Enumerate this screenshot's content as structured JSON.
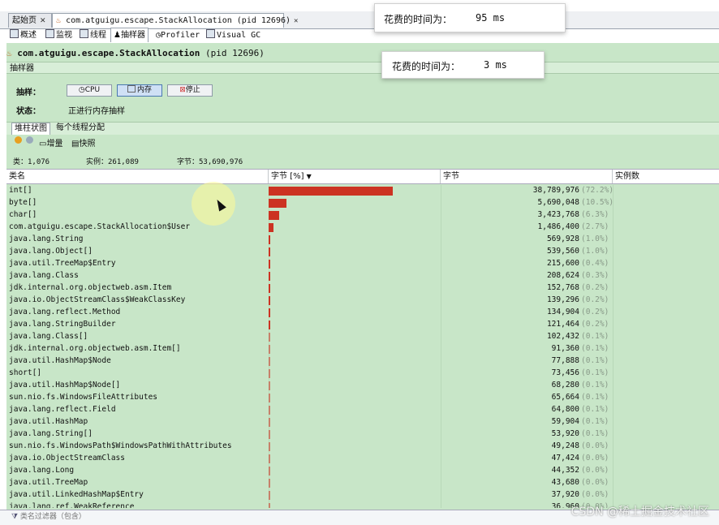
{
  "doc_tabs": [
    {
      "label": "起始页",
      "close": "✕"
    },
    {
      "label": "com.atguigu.escape.StackAllocation (pid 12696)",
      "close": "✕"
    }
  ],
  "sub_tabs": [
    "概述",
    "监视",
    "线程",
    "抽样器",
    "Profiler",
    "Visual GC"
  ],
  "title": {
    "name": "com.atguigu.escape.StackAllocation",
    "pid": "(pid 12696)"
  },
  "sampler_label": "抽样器",
  "sample_label": "抽样：",
  "buttons": {
    "cpu": "CPU",
    "memory": "内存",
    "stop": "停止"
  },
  "status_label": "状态：",
  "status_value": "正进行内存抽样",
  "view_tabs": [
    "堆柱状图",
    "每个线程分配"
  ],
  "toolbar": {
    "delta": "增量",
    "snapshot": "快照"
  },
  "summary": {
    "classes": "类：1,076",
    "instances": "实例：261,089",
    "bytes": "字节：53,690,976"
  },
  "columns": {
    "name": "类名",
    "bytes_pct": "字节 [%]",
    "bytes": "字节",
    "instances": "实例数"
  },
  "rows": [
    {
      "name": "int[]",
      "bytes": "38,789,976",
      "pct": "(72.2%)",
      "frac": 0.722
    },
    {
      "name": "byte[]",
      "bytes": "5,690,048",
      "pct": "(10.5%)",
      "frac": 0.105
    },
    {
      "name": "char[]",
      "bytes": "3,423,768",
      "pct": "(6.3%)",
      "frac": 0.063
    },
    {
      "name": "com.atguigu.escape.StackAllocation$User",
      "bytes": "1,486,400",
      "pct": "(2.7%)",
      "frac": 0.027
    },
    {
      "name": "java.lang.String",
      "bytes": "569,928",
      "pct": "(1.0%)",
      "frac": 0.01
    },
    {
      "name": "java.lang.Object[]",
      "bytes": "539,560",
      "pct": "(1.0%)",
      "frac": 0.01
    },
    {
      "name": "java.util.TreeMap$Entry",
      "bytes": "215,600",
      "pct": "(0.4%)",
      "frac": 0.004
    },
    {
      "name": "java.lang.Class",
      "bytes": "208,624",
      "pct": "(0.3%)",
      "frac": 0.003
    },
    {
      "name": "jdk.internal.org.objectweb.asm.Item",
      "bytes": "152,768",
      "pct": "(0.2%)",
      "frac": 0.002
    },
    {
      "name": "java.io.ObjectStreamClass$WeakClassKey",
      "bytes": "139,296",
      "pct": "(0.2%)",
      "frac": 0.002
    },
    {
      "name": "java.lang.reflect.Method",
      "bytes": "134,904",
      "pct": "(0.2%)",
      "frac": 0.002
    },
    {
      "name": "java.lang.StringBuilder",
      "bytes": "121,464",
      "pct": "(0.2%)",
      "frac": 0.002
    },
    {
      "name": "java.lang.Class[]",
      "bytes": "102,432",
      "pct": "(0.1%)",
      "frac": 0.001
    },
    {
      "name": "jdk.internal.org.objectweb.asm.Item[]",
      "bytes": "91,360",
      "pct": "(0.1%)",
      "frac": 0.001
    },
    {
      "name": "java.util.HashMap$Node",
      "bytes": "77,888",
      "pct": "(0.1%)",
      "frac": 0.001
    },
    {
      "name": "short[]",
      "bytes": "73,456",
      "pct": "(0.1%)",
      "frac": 0.001
    },
    {
      "name": "java.util.HashMap$Node[]",
      "bytes": "68,280",
      "pct": "(0.1%)",
      "frac": 0.001
    },
    {
      "name": "sun.nio.fs.WindowsFileAttributes",
      "bytes": "65,664",
      "pct": "(0.1%)",
      "frac": 0.001
    },
    {
      "name": "java.lang.reflect.Field",
      "bytes": "64,800",
      "pct": "(0.1%)",
      "frac": 0.001
    },
    {
      "name": "java.util.HashMap",
      "bytes": "59,904",
      "pct": "(0.1%)",
      "frac": 0.001
    },
    {
      "name": "java.lang.String[]",
      "bytes": "53,920",
      "pct": "(0.1%)",
      "frac": 0.001
    },
    {
      "name": "sun.nio.fs.WindowsPath$WindowsPathWithAttributes",
      "bytes": "49,248",
      "pct": "(0.0%)",
      "frac": 0.0
    },
    {
      "name": "java.io.ObjectStreamClass",
      "bytes": "47,424",
      "pct": "(0.0%)",
      "frac": 0.0
    },
    {
      "name": "java.lang.Long",
      "bytes": "44,352",
      "pct": "(0.0%)",
      "frac": 0.0
    },
    {
      "name": "java.util.TreeMap",
      "bytes": "43,680",
      "pct": "(0.0%)",
      "frac": 0.0
    },
    {
      "name": "java.util.LinkedHashMap$Entry",
      "bytes": "37,920",
      "pct": "(0.0%)",
      "frac": 0.0
    },
    {
      "name": "java.lang.ref.WeakReference",
      "bytes": "36,960",
      "pct": "(0.0%)",
      "frac": 0.0
    }
  ],
  "filter_placeholder": "类名过滤器（包含）",
  "overlay1": {
    "label": "花费的时间为：",
    "value": "95 ms"
  },
  "overlay2": {
    "label": "花费的时间为：",
    "value": "3 ms"
  },
  "watermark": "CSDN @稀土掘金技术社区"
}
